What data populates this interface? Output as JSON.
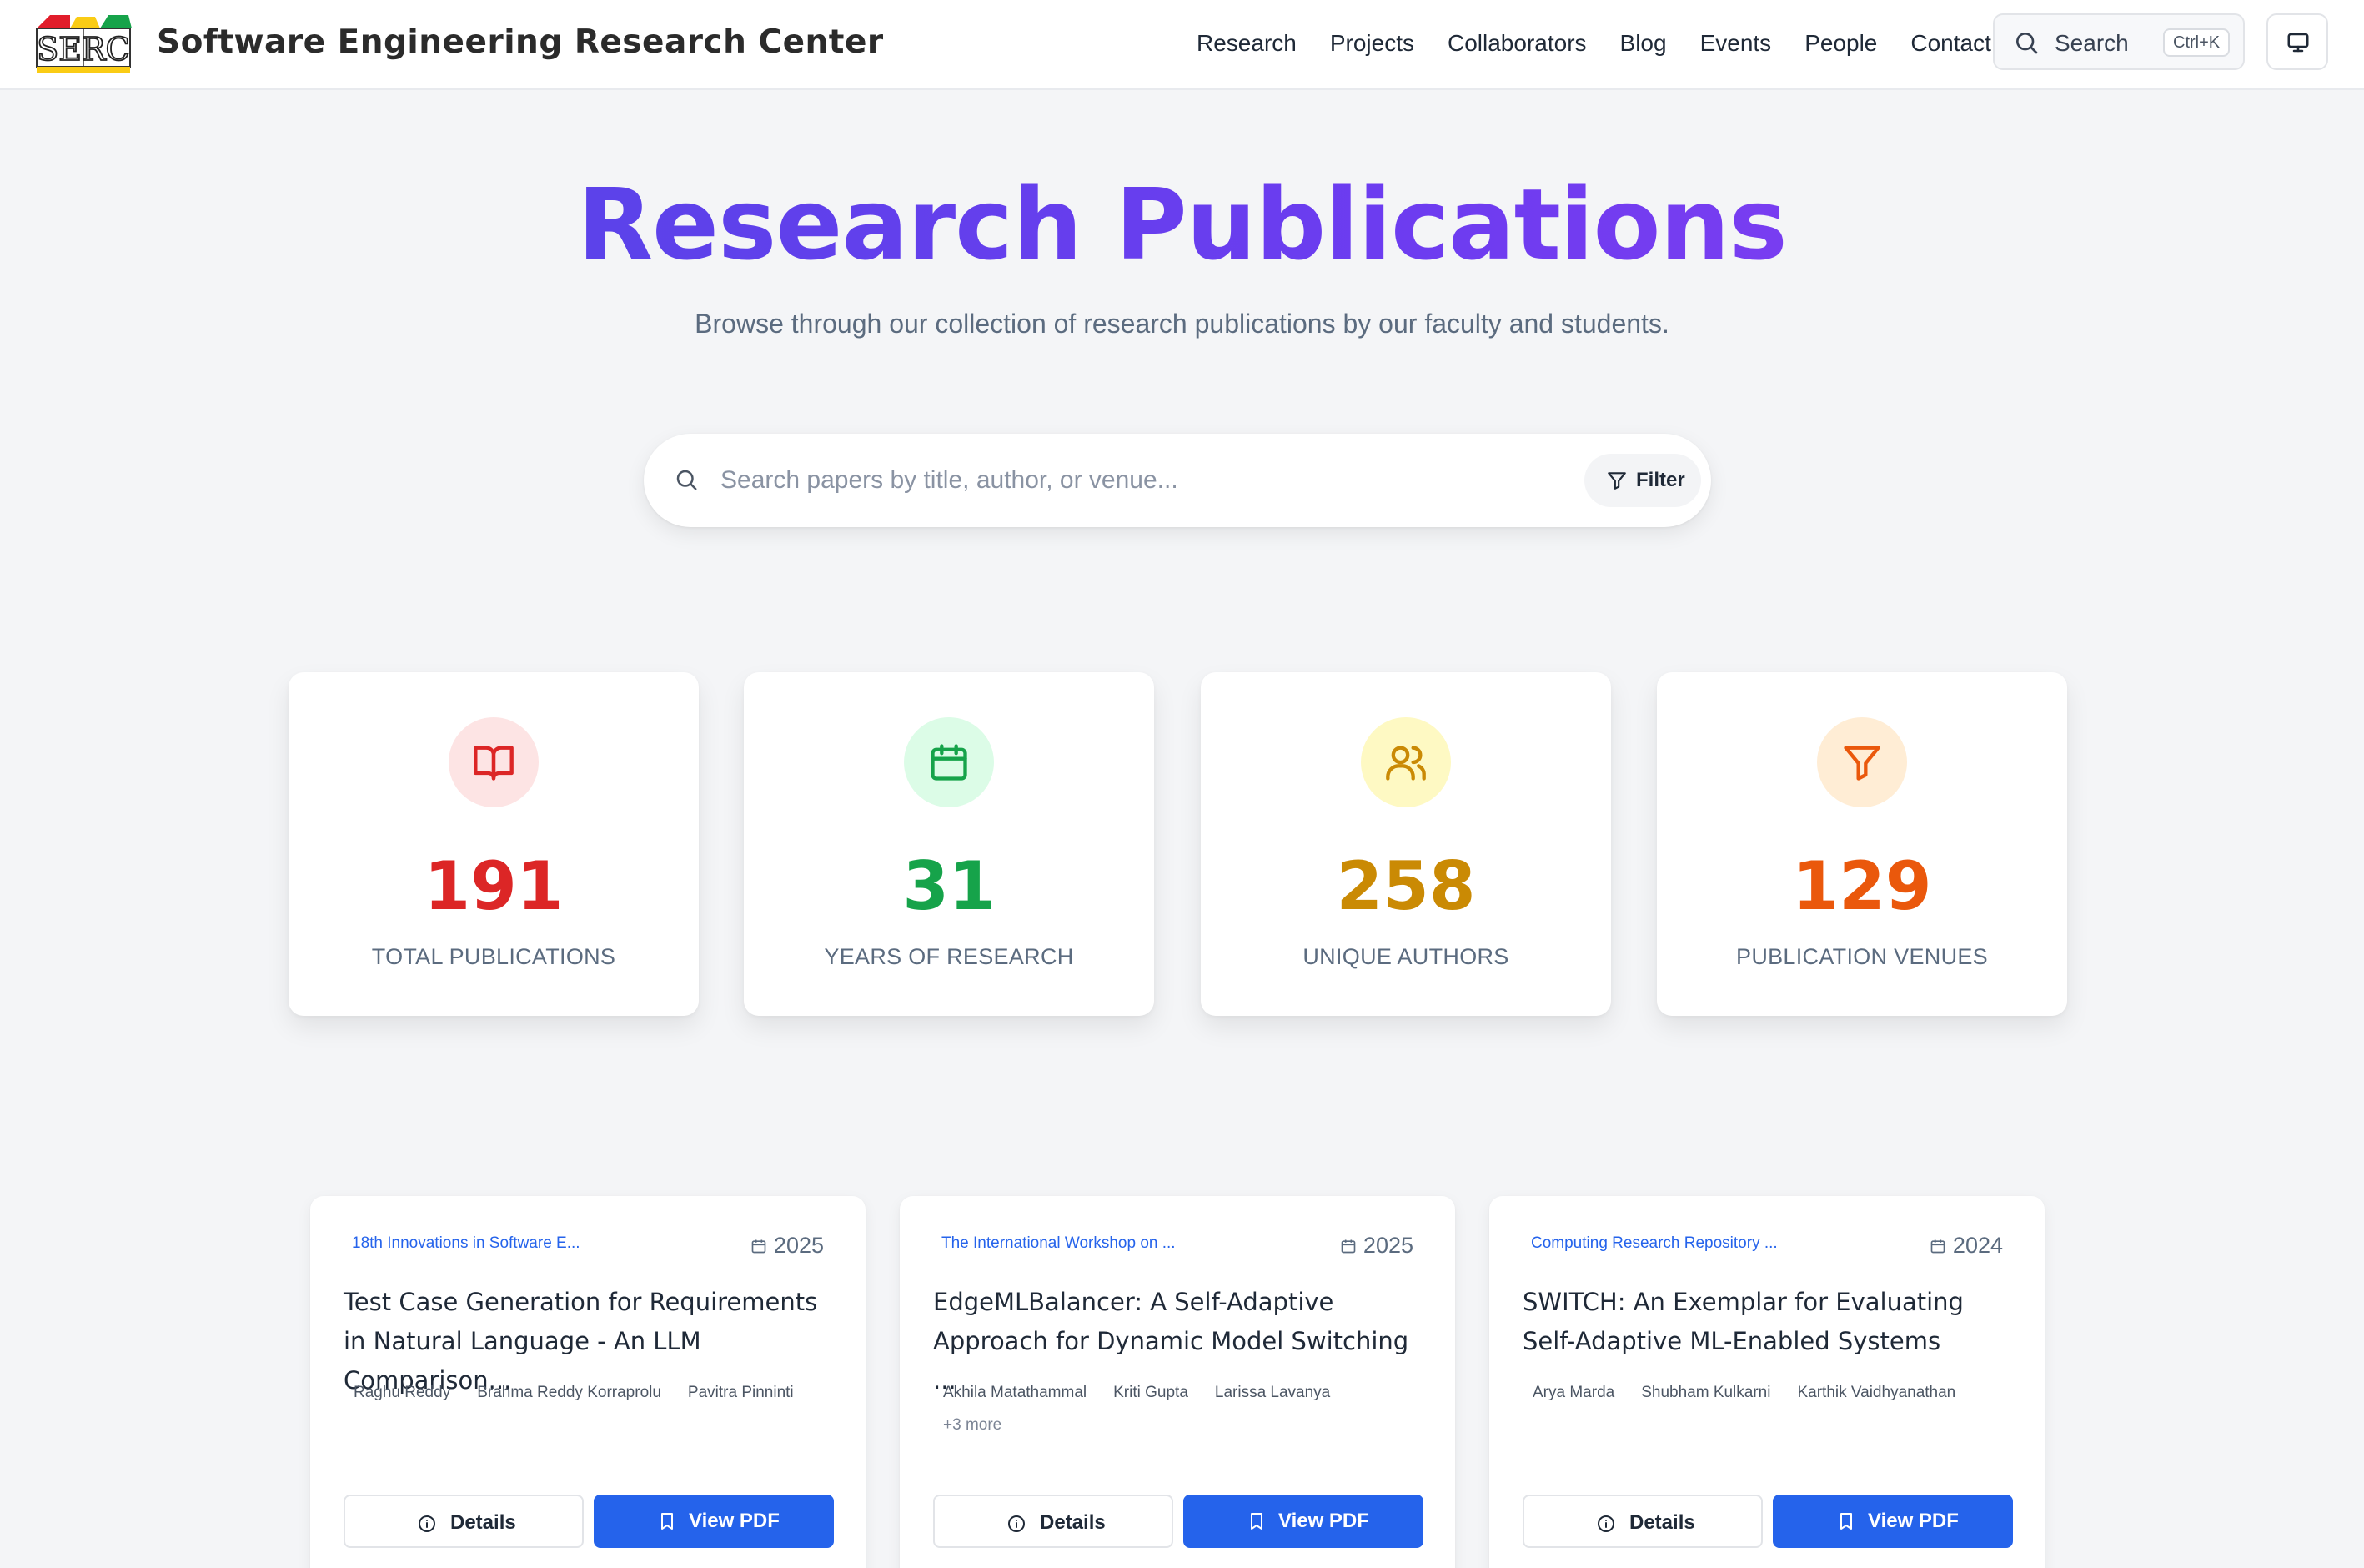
{
  "header": {
    "logo_text": "SERC",
    "brand_name": "Software Engineering Research Center",
    "nav": [
      "Research",
      "Projects",
      "Collaborators",
      "Blog",
      "Events",
      "People",
      "Contact"
    ],
    "search_label": "Search",
    "search_shortcut": "Ctrl+K"
  },
  "hero": {
    "title": "Research Publications",
    "subtitle": "Browse through our collection of research publications by our faculty and students.",
    "search_placeholder": "Search papers by title, author, or venue...",
    "filter_label": "Filter"
  },
  "stats": [
    {
      "value": "191",
      "label": "TOTAL PUBLICATIONS",
      "icon": "book-open-icon",
      "color": "#dc2626",
      "bg": "#fde4e4"
    },
    {
      "value": "31",
      "label": "YEARS OF RESEARCH",
      "icon": "calendar-icon",
      "color": "#16a34a",
      "bg": "#dcfce7"
    },
    {
      "value": "258",
      "label": "UNIQUE AUTHORS",
      "icon": "users-icon",
      "color": "#ca8a04",
      "bg": "#fef9c3"
    },
    {
      "value": "129",
      "label": "PUBLICATION VENUES",
      "icon": "filter-icon",
      "color": "#ea580c",
      "bg": "#ffedd5"
    }
  ],
  "publications": [
    {
      "venue": "18th Innovations in Software E...",
      "year": "2025",
      "title": "Test Case Generation for Requirements in Natural Language - An LLM Comparison...",
      "authors": [
        "Raghu Reddy",
        "Brahma Reddy Korraprolu",
        "Pavitra Pinninti"
      ],
      "more": "",
      "details_label": "Details",
      "pdf_label": "View PDF"
    },
    {
      "venue": "The International Workshop on ...",
      "year": "2025",
      "title": "EdgeMLBalancer: A Self-Adaptive Approach for Dynamic Model Switching ...",
      "authors": [
        "Akhila Matathammal",
        "Kriti Gupta",
        "Larissa Lavanya"
      ],
      "more": "+3 more",
      "details_label": "Details",
      "pdf_label": "View PDF"
    },
    {
      "venue": "Computing Research Repository ...",
      "year": "2024",
      "title": "SWITCH: An Exemplar for Evaluating Self-Adaptive ML-Enabled Systems",
      "authors": [
        "Arya Marda",
        "Shubham Kulkarni",
        "Karthik Vaidhyanathan"
      ],
      "more": "",
      "details_label": "Details",
      "pdf_label": "View PDF"
    }
  ]
}
